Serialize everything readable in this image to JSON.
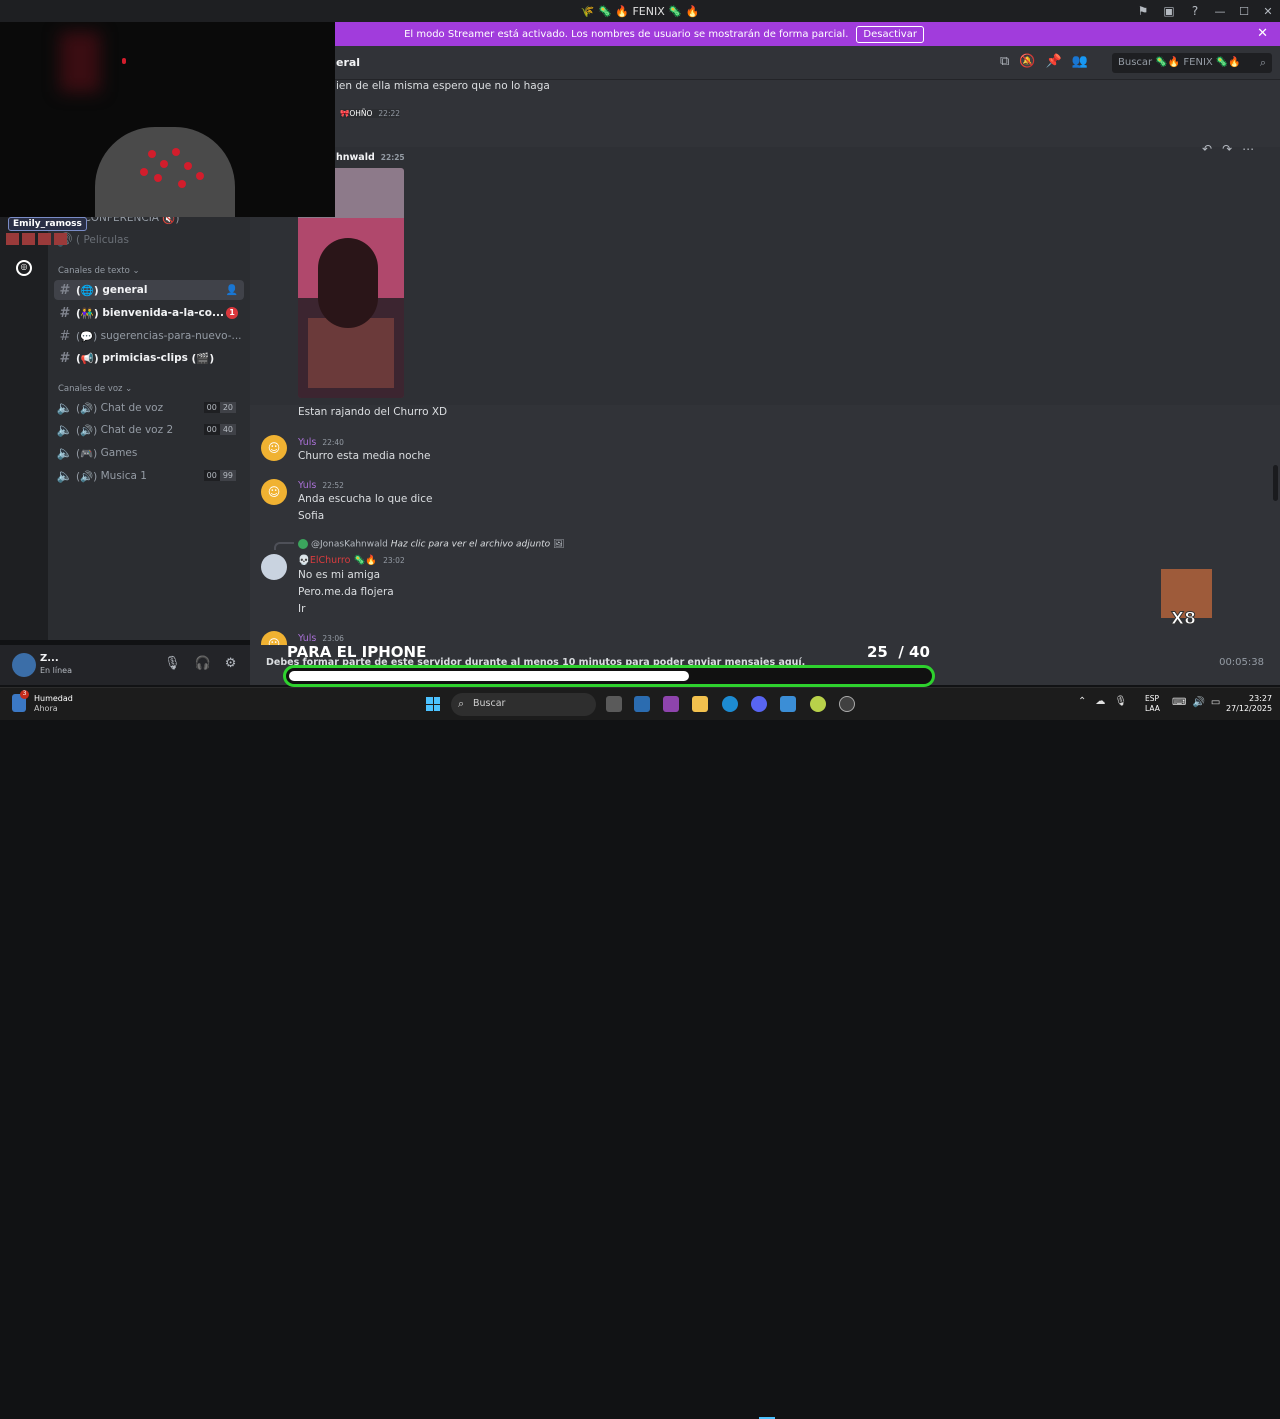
{
  "titlebar": {
    "title": "FENIX",
    "title_emojis_before": "🌾 🦠 🔥",
    "title_emojis_after": "🦠 🔥",
    "controls": [
      "—",
      "☐",
      "✕"
    ]
  },
  "banner": {
    "text": "El modo Streamer está activado. Los nombres de usuario se mostrarán de forma parcial.",
    "button": "Desactivar",
    "close": "✕"
  },
  "channel_header": {
    "name": "eral",
    "search_placeholder": "Buscar 🦠🔥 FENIX 🦠🔥"
  },
  "sidebar": {
    "top_channels": [
      {
        "label": "CONFERENCIA",
        "prefix": "(",
        "suffix": "🔇)"
      },
      {
        "label": "Peliculas",
        "prefix": "(",
        "suffix": ""
      }
    ],
    "text_category": "Canales de texto",
    "text_channels": [
      {
        "label": "general",
        "prefix": "(🌐)",
        "state": "active"
      },
      {
        "label": "bienvenida-a-la-co...",
        "prefix": "(👫)",
        "state": "bold",
        "badge": "1"
      },
      {
        "label": "sugerencias-para-nuevo-...",
        "prefix": "(💬)",
        "state": "muted"
      },
      {
        "label": "primicias-clips",
        "prefix": "(📢)",
        "suffix": "(🎬)",
        "state": "bold"
      }
    ],
    "voice_category": "Canales de voz",
    "voice_channels": [
      {
        "label": "Chat de voz",
        "prefix": "(🔊)",
        "count": "00",
        "limit": "20"
      },
      {
        "label": "Chat de voz 2",
        "prefix": "(🔊)",
        "count": "00",
        "limit": "40"
      },
      {
        "label": "Games",
        "prefix": "(🎮)"
      },
      {
        "label": "Musica 1",
        "prefix": "(🔊)",
        "count": "00",
        "limit": "99"
      }
    ]
  },
  "user_panel": {
    "name": "Z...",
    "status": "En línea"
  },
  "messages": {
    "m0_text": "ien de ella misma espero que no lo haga",
    "m1_tag": "OHÑO",
    "m1_time": "22:22",
    "m2_author": "hnwald",
    "m2_time": "22:25",
    "m2_text": "Estan rajando del Churro XD",
    "m3_author": "Yuls",
    "m3_time": "22:40",
    "m3_text": "Churro esta media noche",
    "m4_author": "Yuls",
    "m4_time": "22:52",
    "m4_text1": "Anda escucha lo que dice",
    "m4_text2": "Sofia",
    "reply_user": "@JonasKahnwald",
    "reply_text": "Haz clic para ver el archivo adjunto",
    "m5_author": "ElChurro",
    "m5_time": "23:02",
    "m5_text1": "No es mi amiga",
    "m5_text2": "Pero.me.da flojera",
    "m5_text3": "Ir",
    "m6_author": "Yuls",
    "m6_time": "23:06"
  },
  "composer": {
    "notice": "Debes formar parte de este servidor durante al menos 10 minutos para poder enviar mensajes aquí.",
    "timer": "00:05:38"
  },
  "overlays": {
    "streamer_name": "Emily_ramoss",
    "goal_title": "PARA EL IPHONE",
    "goal_current": "25",
    "goal_total": "/ 40",
    "goal_progress": 0.625,
    "sticker_text": "X8"
  },
  "taskbar": {
    "weather_title": "Humedad",
    "weather_sub": "Ahora",
    "weather_badge": "3",
    "search": "Buscar",
    "lang_top": "ESP",
    "lang_bottom": "LAA",
    "time": "23:27",
    "date": "27/12/2025"
  },
  "colors": {
    "accent": "#a13cdc",
    "goal_border": "#2ed12e",
    "bot_avatar": "#f0b232",
    "author": "#a970d6",
    "elchurro": "#d83c3e"
  }
}
